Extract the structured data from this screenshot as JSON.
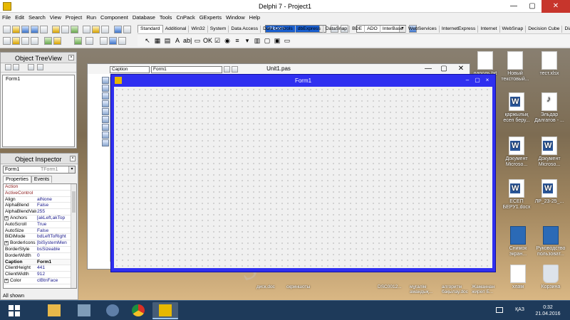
{
  "ide": {
    "title": "Delphi 7 - Project1",
    "menu": [
      "File",
      "Edit",
      "Search",
      "View",
      "Project",
      "Run",
      "Component",
      "Database",
      "Tools",
      "CnPack",
      "GExperts",
      "Window",
      "Help"
    ],
    "config_combo": "<None>",
    "palette_tabs": [
      "Standard",
      "Additional",
      "Win32",
      "System",
      "Data Access",
      "Data Controls",
      "dbExpress",
      "DataSnap",
      "BDE",
      "ADO",
      "InterBase",
      "WebServices",
      "InternetExpress",
      "Internet",
      "WebSnap",
      "Decision Cube",
      "Dialo"
    ],
    "active_tab": "Standard",
    "palette_glyphs": [
      "↖",
      "▦",
      "▤",
      "A",
      "ab|",
      "▭",
      "OK",
      "☑",
      "◉",
      "≡",
      "▾",
      "▥",
      "▢",
      "▣",
      "▭"
    ]
  },
  "treeview": {
    "title": "Object TreeView",
    "node": "Form1"
  },
  "inspector": {
    "title": "Object Inspector",
    "object": "Form1",
    "object_class": "TForm1",
    "tabs": [
      "Properties",
      "Events"
    ],
    "rows": [
      {
        "name": "Action",
        "value": "",
        "kind": "event"
      },
      {
        "name": "ActiveControl",
        "value": "",
        "kind": "event"
      },
      {
        "name": "Align",
        "value": "alNone",
        "kind": "prop"
      },
      {
        "name": "AlphaBlend",
        "value": "False",
        "kind": "prop"
      },
      {
        "name": "AlphaBlendValu",
        "value": "255",
        "kind": "prop"
      },
      {
        "name": "Anchors",
        "value": "[akLeft,akTop",
        "kind": "group"
      },
      {
        "name": "AutoScroll",
        "value": "True",
        "kind": "prop"
      },
      {
        "name": "AutoSize",
        "value": "False",
        "kind": "prop"
      },
      {
        "name": "BiDiMode",
        "value": "bdLeftToRight",
        "kind": "prop"
      },
      {
        "name": "BorderIcons",
        "value": "[biSystemMen",
        "kind": "group"
      },
      {
        "name": "BorderStyle",
        "value": "bsSizeable",
        "kind": "prop"
      },
      {
        "name": "BorderWidth",
        "value": "0",
        "kind": "prop"
      },
      {
        "name": "Caption",
        "value": "Form1",
        "kind": "selected"
      },
      {
        "name": "ClientHeight",
        "value": "441",
        "kind": "prop"
      },
      {
        "name": "ClientWidth",
        "value": "912",
        "kind": "prop"
      },
      {
        "name": "Color",
        "value": "clBtnFace",
        "kind": "group"
      }
    ],
    "status": "All shown"
  },
  "editor": {
    "title": "Unit1.pas",
    "object_combo": "Caption",
    "value_combo": "Form1"
  },
  "form": {
    "title": "Form1"
  },
  "desktop_icons": [
    {
      "label": "пароль.txt",
      "kind": "txt"
    },
    {
      "label": "Новый текстовый...",
      "kind": "txt"
    },
    {
      "label": "тест.xlsx",
      "kind": "txt"
    },
    {
      "label": "қаржылық есеп беру...",
      "kind": "word"
    },
    {
      "label": "Эльдар Далгатов - ...",
      "kind": "mp3"
    },
    {
      "label": "Документ Microso...",
      "kind": "word"
    },
    {
      "label": "Документ Microso...",
      "kind": "word"
    },
    {
      "label": "ЕСЕП БЕРУ1.docx",
      "kind": "word"
    },
    {
      "label": "ЛР_23-25_...",
      "kind": "word"
    },
    {
      "label": "Снимок экран...",
      "kind": "pc"
    },
    {
      "label": "Руководство пользоват...",
      "kind": "pc"
    },
    {
      "label": "хлам",
      "kind": "txt"
    },
    {
      "label": "Корзина",
      "kind": "trash"
    }
  ],
  "bottom_labels": [
    "диск.doc",
    "скриншоты",
    "DSC0012...",
    "мұғалім амандық...",
    "алгоритм бақылау.doc",
    "Жаманнан жиреп Б..."
  ],
  "taskbar": {
    "apps": [
      "file-explorer",
      "network",
      "media",
      "chrome",
      "delphi"
    ],
    "language": "ҚАЗ",
    "time": "0:32",
    "date": "21.04.2016"
  },
  "watermark": "Stud.kz"
}
